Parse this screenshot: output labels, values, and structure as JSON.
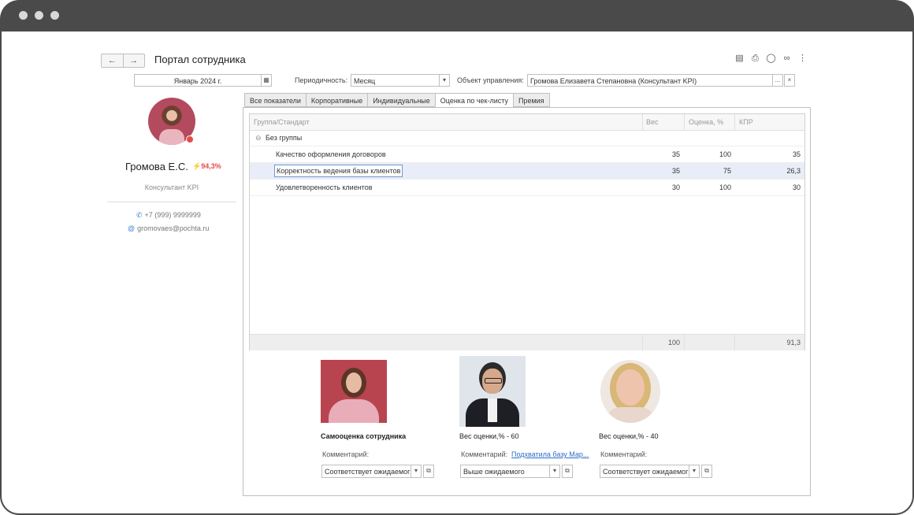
{
  "header": {
    "back_icon": "arrow-left-icon",
    "forward_icon": "arrow-right-icon",
    "title": "Портал сотрудника",
    "toolbar_icons": [
      "save-icon",
      "print-icon",
      "preview-icon",
      "link-icon",
      "more-icon"
    ]
  },
  "filters": {
    "period_value": "Январь 2024 г.",
    "periodicity_label": "Периодичность:",
    "periodicity_value": "Месяц",
    "object_label": "Объект управления:",
    "object_value": "Громова Елизавета Степановна (Консультант KPI)",
    "ellipsis": "...",
    "clear": "×"
  },
  "profile": {
    "name": "Громова Е.С.",
    "score": "94,3%",
    "role": "Консультант KPI",
    "phone": "+7 (999) 9999999",
    "email": "gromovaes@pochta.ru",
    "status_color": "#e84a4a"
  },
  "tabs": [
    {
      "label": "Все показатели"
    },
    {
      "label": "Корпоративные"
    },
    {
      "label": "Индивидуальные"
    },
    {
      "label": "Оценка по чек-листу"
    },
    {
      "label": "Премия"
    }
  ],
  "active_tab": "Оценка по чек-листу",
  "table": {
    "columns": [
      "Группа/Стандарт",
      "Вес",
      "Оценка, %",
      "КПР"
    ],
    "group": "Без группы",
    "rows": [
      {
        "name": "Качество оформления договоров",
        "weight": "35",
        "score": "100",
        "kpr": "35"
      },
      {
        "name": "Корректность ведения базы клиентов",
        "weight": "35",
        "score": "75",
        "kpr": "26,3"
      },
      {
        "name": "Удовлетворенность клиентов",
        "weight": "30",
        "score": "100",
        "kpr": "30"
      }
    ],
    "total_weight": "100",
    "total_kpr": "91,3"
  },
  "evaluations": [
    {
      "title": "Самооценка сотрудника",
      "comment_label": "Комментарий:",
      "comment": "",
      "rating": "Соответствует ожидаемог"
    },
    {
      "title": "Вес оценки,% - 60",
      "comment_label": "Комментарий:",
      "comment": "Подхватила базу Мар...",
      "rating": "Выше ожидаемого"
    },
    {
      "title": "Вес оценки,% - 40",
      "comment_label": "Комментарий:",
      "comment": "",
      "rating": "Соответствует ожидаемог"
    }
  ]
}
